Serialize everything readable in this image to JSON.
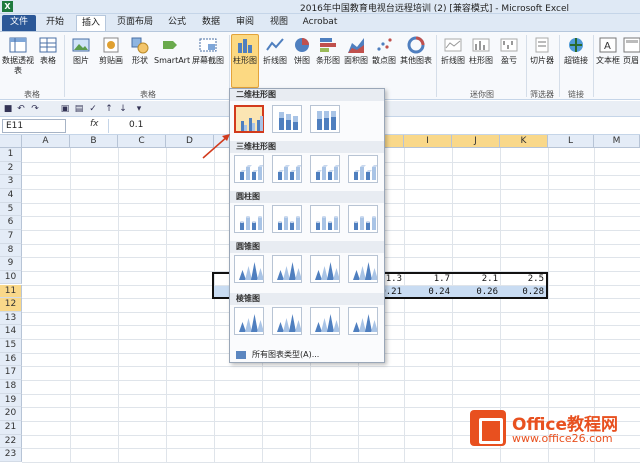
{
  "window": {
    "title": "2016年中国教育电视台远程培训 (2)  [兼容模式] - Microsoft Excel"
  },
  "tabs": [
    "文件",
    "开始",
    "插入",
    "页面布局",
    "公式",
    "数据",
    "审阅",
    "视图",
    "Acrobat"
  ],
  "active_tab": "插入",
  "ribbon": {
    "buttons": [
      "数据透视表",
      "表格",
      "图片",
      "剪贴画",
      "形状",
      "SmartArt",
      "屏幕截图",
      "柱形图",
      "折线图",
      "饼图",
      "条形图",
      "面积图",
      "散点图",
      "其他图表",
      "折线图",
      "柱形图",
      "盈亏",
      "切片器",
      "超链接",
      "文本框",
      "页眉"
    ],
    "groups": [
      "表格",
      "插图",
      "迷你图",
      "筛选器",
      "链接"
    ]
  },
  "formula": {
    "cell_ref": "E11",
    "fx": "fx",
    "value": "0.1"
  },
  "sheet": {
    "columns": [
      "A",
      "B",
      "C",
      "D",
      "E",
      "F",
      "G",
      "H",
      "I",
      "J",
      "K",
      "L",
      "M"
    ],
    "rows": [
      "1",
      "2",
      "3",
      "4",
      "5",
      "6",
      "7",
      "8",
      "9",
      "10",
      "11",
      "12",
      "13",
      "14",
      "15",
      "16",
      "17",
      "18",
      "19",
      "20",
      "21",
      "22",
      "23"
    ],
    "row11": [
      "1.3",
      "1.7",
      "2.1",
      "2.5"
    ],
    "row12": [
      "0.21",
      "0.24",
      "0.26",
      "0.28"
    ]
  },
  "dropdown": {
    "sections": [
      "二维柱形图",
      "三维柱形图",
      "圆柱图",
      "圆锥图",
      "棱锥图"
    ],
    "all_types": "所有图表类型(A)..."
  },
  "watermark": {
    "title": "Office教程网",
    "url": "www.office26.com"
  },
  "colors": {
    "file_tab": "#2b5797",
    "highlight": "#fcd982",
    "selection_border": "#d23a1c"
  }
}
